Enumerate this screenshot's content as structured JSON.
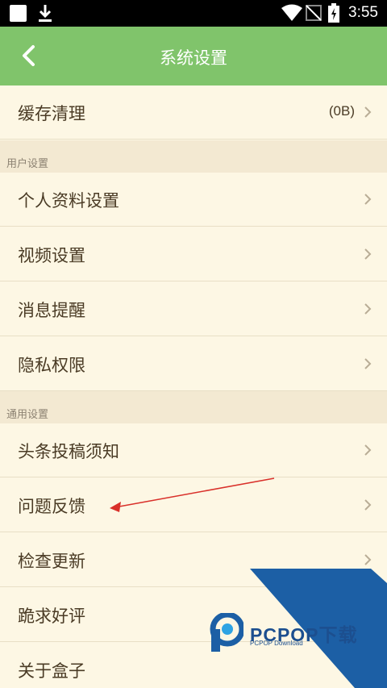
{
  "status_bar": {
    "time": "3:55"
  },
  "app_bar": {
    "title": "系统设置",
    "back_icon": "chevron-left-icon"
  },
  "cache_row": {
    "label": "缓存清理",
    "value": "(0B)"
  },
  "sections": [
    {
      "title": "用户设置",
      "items": [
        "个人资料设置",
        "视频设置",
        "消息提醒",
        "隐私权限"
      ]
    },
    {
      "title": "通用设置",
      "items": [
        "头条投稿须知",
        "问题反馈",
        "检查更新",
        "跪求好评",
        "关于盒子"
      ]
    }
  ],
  "watermark": {
    "brand": "PCPOP下载",
    "subtitle": "PCPOP Download"
  },
  "colors": {
    "app_bar": "#80c46b",
    "background": "#fdf7e4",
    "section_header": "#f3e9d2",
    "annotation_arrow": "#d9302a",
    "watermark": "#1c4f8f"
  }
}
